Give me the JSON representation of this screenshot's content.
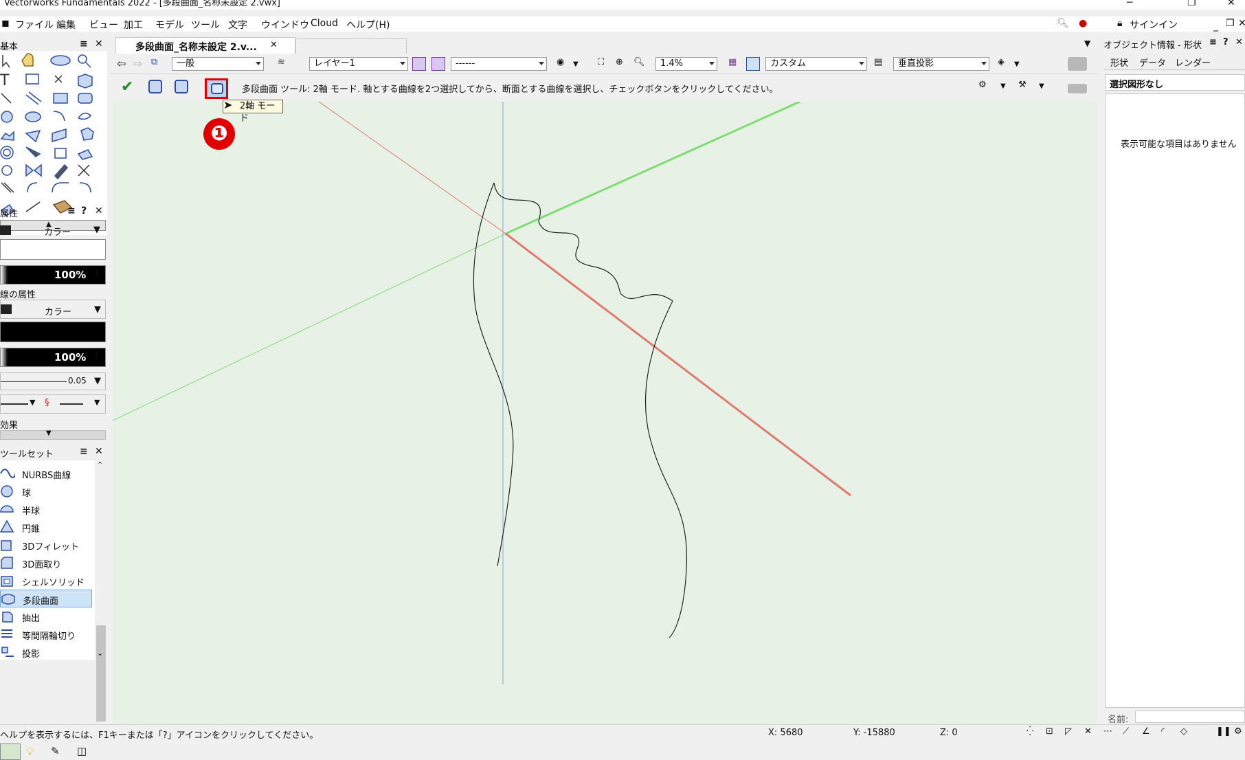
{
  "window": {
    "title": "Vectorworks Fundamentals 2022 - [多段曲面_名称未設定 2.vwx]"
  },
  "menu": [
    "ファイル",
    "編集",
    "ビュー",
    "加工",
    "モデル",
    "ツール",
    "文字",
    "ウインドウ",
    "Cloud",
    "ヘルプ(H)"
  ],
  "topright": {
    "signin": "サインイン"
  },
  "basic_palette": {
    "title": "基本"
  },
  "attributes": {
    "title": "属性",
    "fill_type": "カラー",
    "fill_opacity": "100%",
    "line_section": "線の属性",
    "line_type": "カラー",
    "line_opacity": "100%",
    "line_thickness": "0.05",
    "effects": "効果"
  },
  "toolset": {
    "title": "ツールセット",
    "items": [
      {
        "label": "NURBS曲線",
        "icon": "nurbs-curve-icon"
      },
      {
        "label": "球",
        "icon": "sphere-icon"
      },
      {
        "label": "半球",
        "icon": "hemisphere-icon"
      },
      {
        "label": "円錐",
        "icon": "cone-icon"
      },
      {
        "label": "3Dフィレット",
        "icon": "fillet-icon"
      },
      {
        "label": "3D面取り",
        "icon": "chamfer-icon"
      },
      {
        "label": "シェルソリッド",
        "icon": "shell-icon"
      },
      {
        "label": "多段曲面",
        "icon": "loft-icon",
        "selected": true
      },
      {
        "label": "抽出",
        "icon": "extract-icon"
      },
      {
        "label": "等間隔輪切り",
        "icon": "contour-icon"
      },
      {
        "label": "投影",
        "icon": "project-icon"
      }
    ]
  },
  "doc_tab": {
    "label": "多段曲面_名称未設定 2.v..."
  },
  "view_bar": {
    "class": "一般",
    "layer": "レイヤー1",
    "sheet": "------",
    "zoom": "1.4%",
    "render": "カスタム",
    "projection": "垂直投影"
  },
  "mode_bar": {
    "hint": "多段曲面 ツール: 2軸 モード. 軸とする曲線を2つ選択してから、断面とする曲線を選択し、チェックボタンをクリックしてください。",
    "tooltip": "2軸 モード",
    "badge": "❶"
  },
  "obj_info": {
    "title": "オブジェクト情報 - 形状",
    "tabs": [
      "形状",
      "データ",
      "レンダー"
    ],
    "selection": "選択図形なし",
    "empty_msg": "表示可能な項目はありません",
    "name_label": "名前:"
  },
  "status": {
    "help": "ヘルプを表示するには、F1キーまたは「?」アイコンをクリックしてください。",
    "x": "X: 5680",
    "y": "Y: -15880",
    "z": "Z: 0"
  },
  "colors": {
    "canvas": "#e8f1e6",
    "x_axis": "#e07a6e",
    "y_axis": "#7fdc74",
    "z_axis": "#8c9ee0",
    "highlight": "#e00000",
    "selected_item": "#cde3f7"
  }
}
